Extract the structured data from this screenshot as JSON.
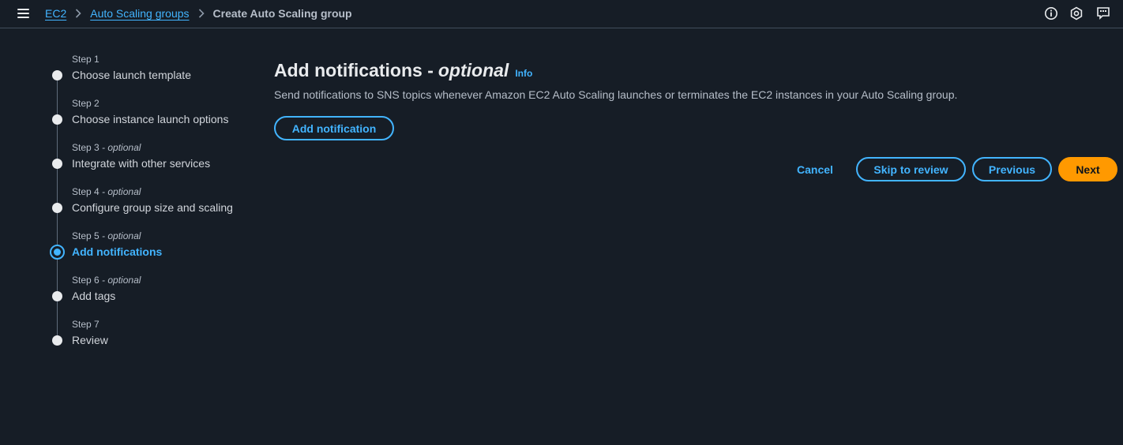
{
  "breadcrumb": {
    "items": [
      "EC2",
      "Auto Scaling groups"
    ],
    "current": "Create Auto Scaling group"
  },
  "icons": {
    "menu": "hamburger-menu-icon",
    "info": "info-circle-icon",
    "settings": "hexagon-settings-icon",
    "feedback": "feedback-icon"
  },
  "steps": [
    {
      "number": "Step 1",
      "optional": "",
      "title": "Choose launch template",
      "state": "done"
    },
    {
      "number": "Step 2",
      "optional": "",
      "title": "Choose instance launch options",
      "state": "done"
    },
    {
      "number": "Step 3",
      "optional": " - optional",
      "title": "Integrate with other services",
      "state": "done"
    },
    {
      "number": "Step 4",
      "optional": " - optional",
      "title": "Configure group size and scaling",
      "state": "done"
    },
    {
      "number": "Step 5",
      "optional": " - optional",
      "title": "Add notifications",
      "state": "active"
    },
    {
      "number": "Step 6",
      "optional": " - optional",
      "title": "Add tags",
      "state": "todo"
    },
    {
      "number": "Step 7",
      "optional": "",
      "title": "Review",
      "state": "todo"
    }
  ],
  "main": {
    "title": "Add notifications -",
    "title_optional": "optional",
    "info": "Info",
    "description": "Send notifications to SNS topics whenever Amazon EC2 Auto Scaling launches or terminates the EC2 instances in your Auto Scaling group.",
    "add_notification_label": "Add notification"
  },
  "actions": {
    "cancel": "Cancel",
    "skip": "Skip to review",
    "previous": "Previous",
    "next": "Next"
  },
  "colors": {
    "background": "#161d26",
    "link": "#42b4ff",
    "primary": "#ff9900"
  }
}
